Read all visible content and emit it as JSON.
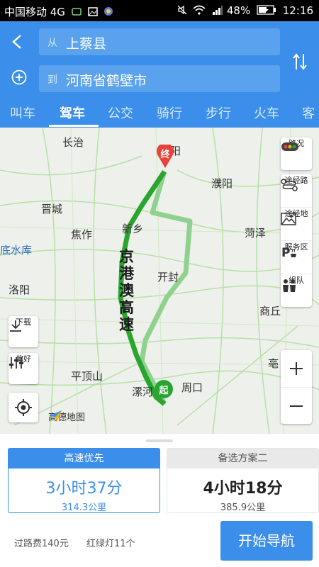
{
  "status_bar": {
    "carrier": "中国移动 4G",
    "battery": "48%",
    "time": "12:16"
  },
  "header": {
    "from_prefix": "从",
    "from_value": "上蔡县",
    "to_prefix": "到",
    "to_value": "河南省鹤壁市",
    "tabs": [
      "叫车",
      "驾车",
      "公交",
      "骑行",
      "步行",
      "火车",
      "客"
    ],
    "active_tab": "驾车"
  },
  "map": {
    "cities": [
      {
        "name": "长治"
      },
      {
        "name": "阳"
      },
      {
        "name": "濮阳"
      },
      {
        "name": "晋城"
      },
      {
        "name": "新乡"
      },
      {
        "name": "焦作"
      },
      {
        "name": "菏泽"
      },
      {
        "name": "底水库"
      },
      {
        "name": "开封"
      },
      {
        "name": "洛阳"
      },
      {
        "name": "商丘"
      },
      {
        "name": "平顶山"
      },
      {
        "name": "漯河"
      },
      {
        "name": "周口"
      },
      {
        "name": "亳"
      }
    ],
    "road_label": "京港澳高速",
    "start_marker": "起",
    "end_marker": "终",
    "logo": "高德地图",
    "controls": {
      "traffic": "路况",
      "waypoint_road": "途经路",
      "waypoint_place": "途经地",
      "service_area": "服务区",
      "team": "组队",
      "download": "下载",
      "preference": "偏好"
    }
  },
  "routes": [
    {
      "label": "高速优先",
      "time": "3小时37分",
      "distance": "314.3公里"
    },
    {
      "label": "备选方案二",
      "time": "4小时18分",
      "distance": "385.9公里"
    }
  ],
  "summary": {
    "toll": "过路费140元",
    "lights": "红绿灯11个"
  },
  "start_button": "开始导航",
  "colors": {
    "primary": "#3b8eea",
    "route_main": "#2aa52f",
    "route_alt": "#8fd28e",
    "end_marker": "#e8423a"
  }
}
